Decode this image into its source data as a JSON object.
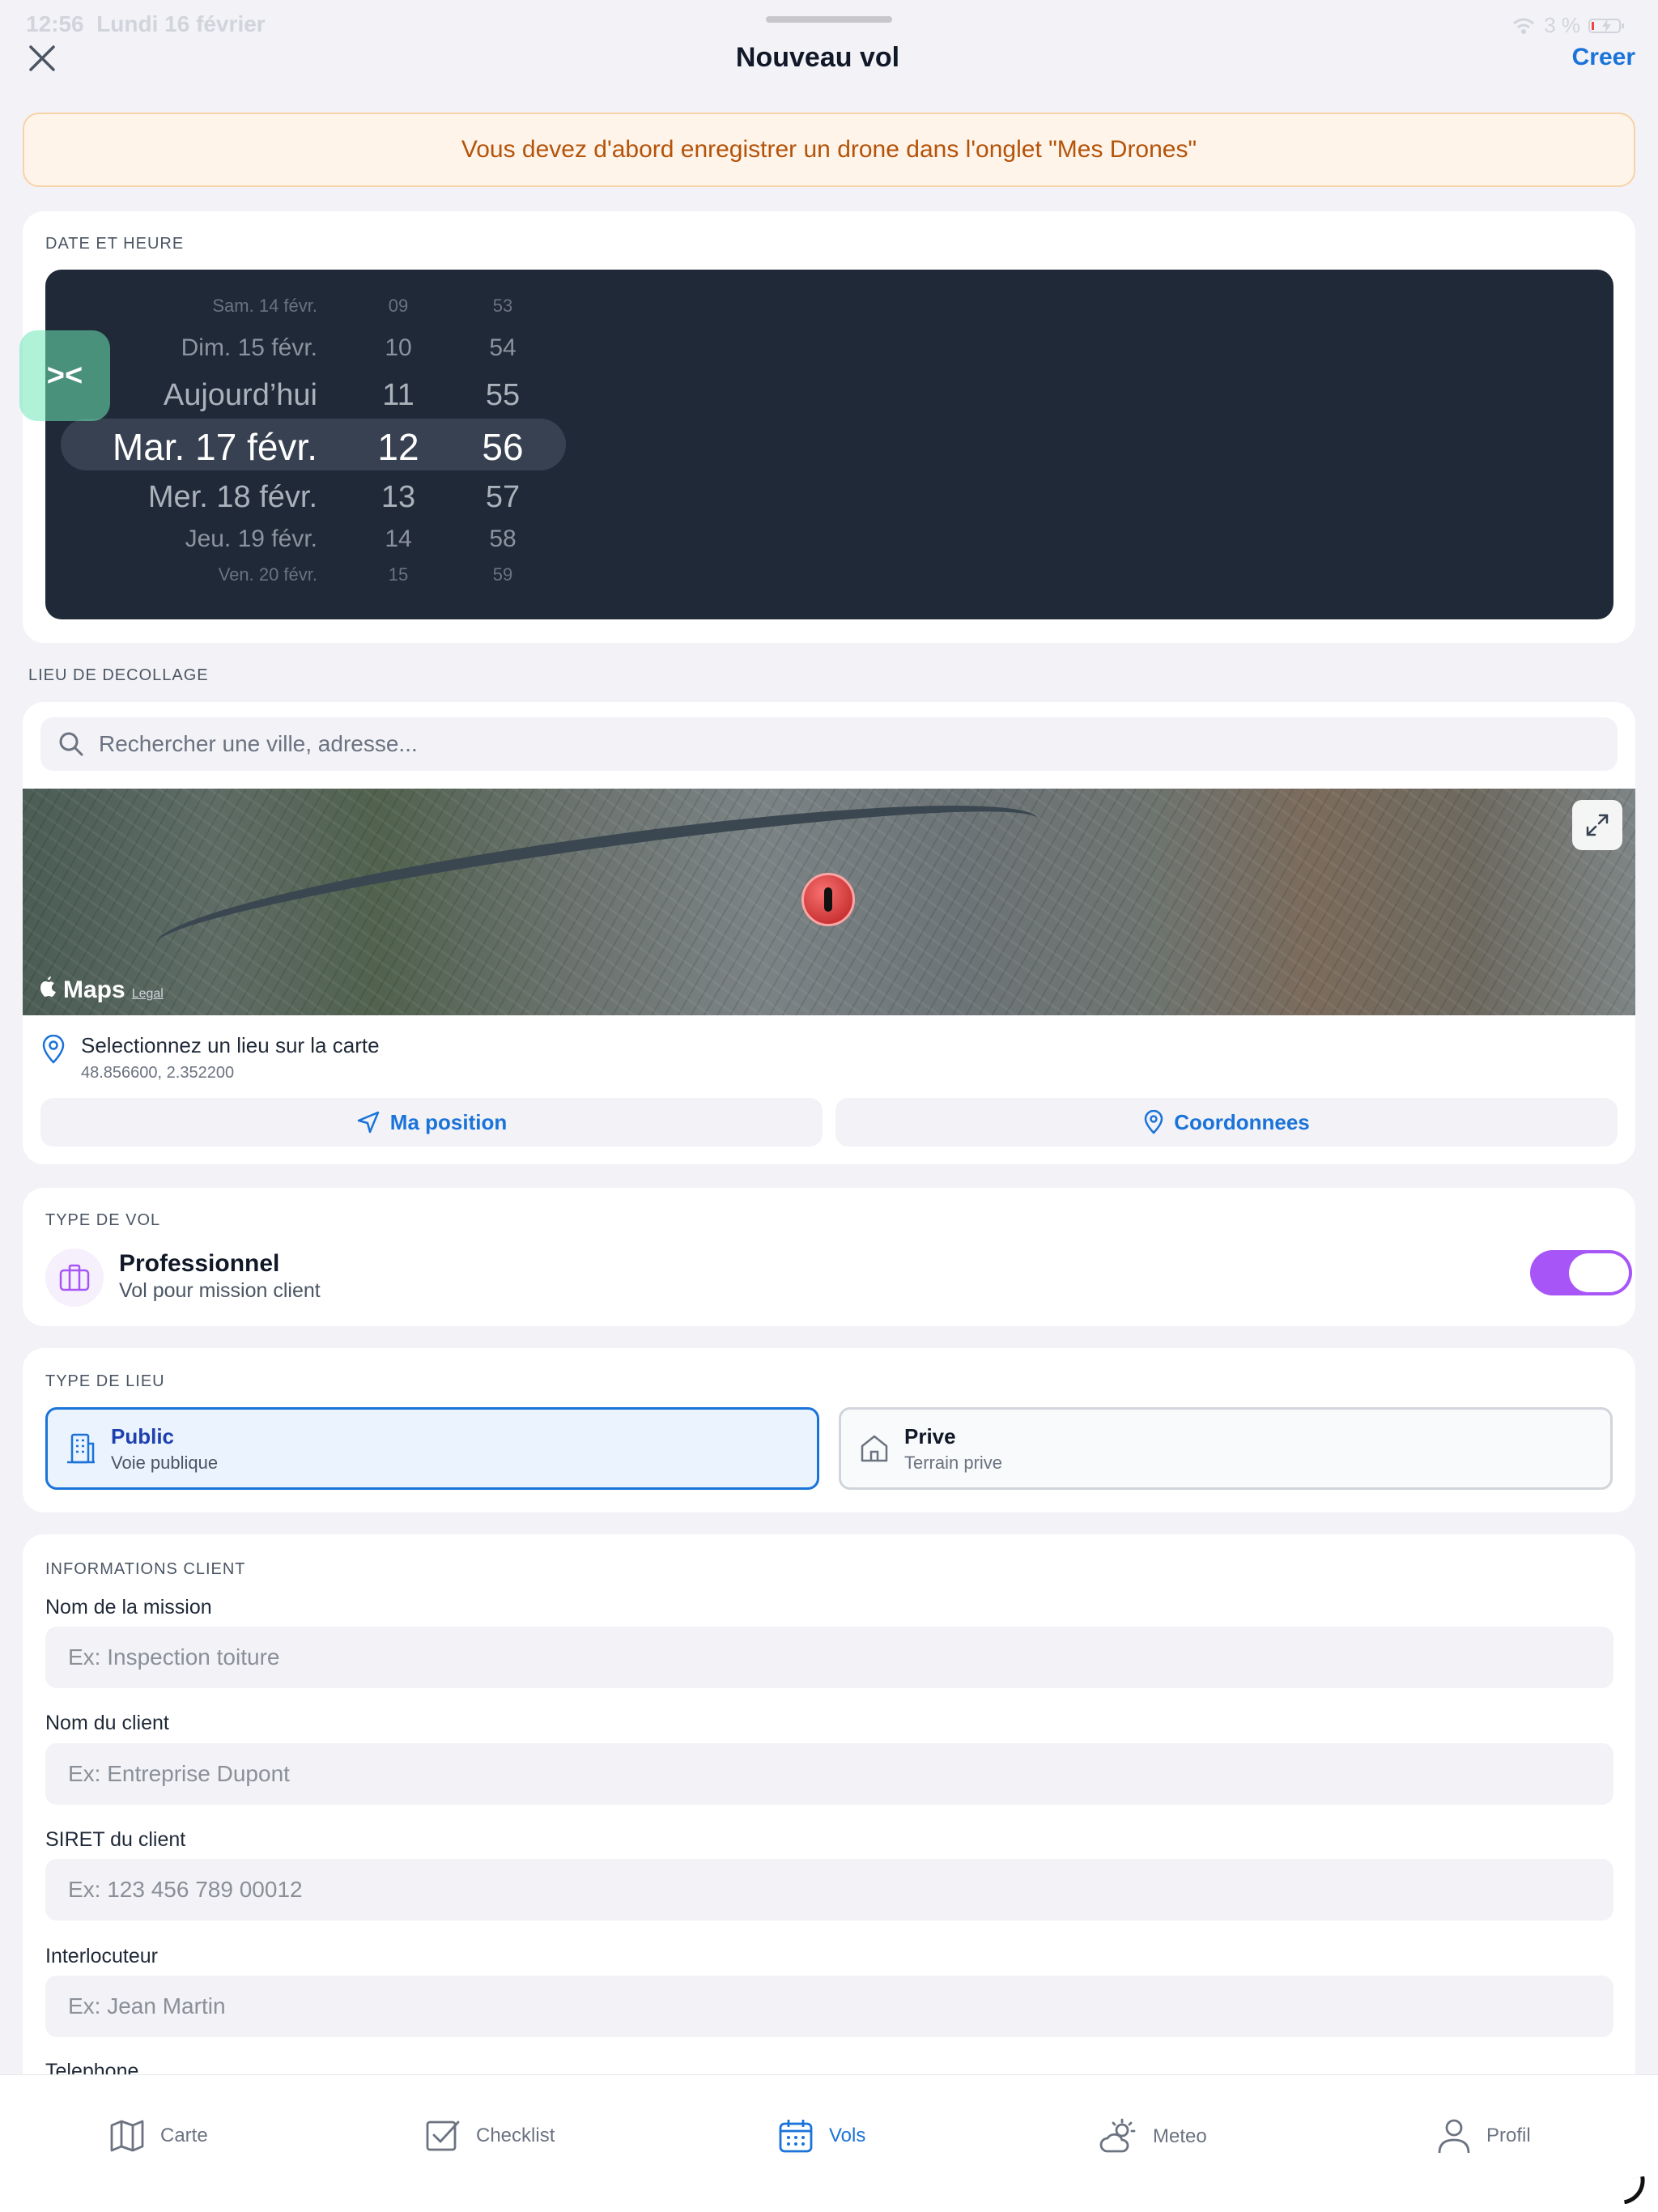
{
  "status_bar": {
    "time": "12:56",
    "date": "Lundi 16 février",
    "battery": "3 %"
  },
  "nav": {
    "title": "Nouveau vol",
    "create_label": "Creer"
  },
  "warning": "Vous devez d'abord enregistrer un drone dans l'onglet \"Mes Drones\"",
  "date_section": {
    "label": "DATE ET HEURE",
    "rows": [
      {
        "day": "Sam. 14 févr.",
        "hour": "09",
        "minute": "53"
      },
      {
        "day": "Dim. 15 févr.",
        "hour": "10",
        "minute": "54"
      },
      {
        "day": "Aujourd’hui",
        "hour": "11",
        "minute": "55"
      },
      {
        "day": "Mar. 17 févr.",
        "hour": "12",
        "minute": "56"
      },
      {
        "day": "Mer. 18 févr.",
        "hour": "13",
        "minute": "57"
      },
      {
        "day": "Jeu. 19 févr.",
        "hour": "14",
        "minute": "58"
      },
      {
        "day": "Ven. 20 févr.",
        "hour": "15",
        "minute": "59"
      }
    ],
    "handle_glyph": "><"
  },
  "takeoff": {
    "label": "LIEU DE DECOLLAGE",
    "search_placeholder": "Rechercher une ville, adresse...",
    "maps_brand": "Maps",
    "maps_legal": "Legal",
    "location_text": "Selectionnez un lieu sur la carte",
    "coordinates": "48.856600, 2.352200",
    "my_position_label": "Ma position",
    "coordinates_label": "Coordonnees"
  },
  "flight_type": {
    "label": "TYPE DE VOL",
    "title": "Professionnel",
    "subtitle": "Vol pour mission client",
    "toggle_on": true
  },
  "place_type": {
    "label": "TYPE DE LIEU",
    "options": [
      {
        "title": "Public",
        "subtitle": "Voie publique",
        "selected": true
      },
      {
        "title": "Prive",
        "subtitle": "Terrain prive",
        "selected": false
      }
    ]
  },
  "client_info": {
    "label": "INFORMATIONS CLIENT",
    "fields": [
      {
        "label": "Nom de la mission",
        "placeholder": "Ex: Inspection toiture"
      },
      {
        "label": "Nom du client",
        "placeholder": "Ex: Entreprise Dupont"
      },
      {
        "label": "SIRET du client",
        "placeholder": "Ex: 123 456 789 00012"
      },
      {
        "label": "Interlocuteur",
        "placeholder": "Ex: Jean Martin"
      },
      {
        "label": "Telephone",
        "placeholder": ""
      }
    ]
  },
  "tabs": [
    {
      "label": "Carte",
      "icon": "map-icon",
      "active": false
    },
    {
      "label": "Checklist",
      "icon": "checklist-icon",
      "active": false
    },
    {
      "label": "Vols",
      "icon": "calendar-icon",
      "active": true
    },
    {
      "label": "Meteo",
      "icon": "weather-icon",
      "active": false
    },
    {
      "label": "Profil",
      "icon": "user-icon",
      "active": false
    }
  ],
  "colors": {
    "accent": "#1a73d9",
    "toggle": "#a855f7",
    "warning_text": "#b45309",
    "picker_bg": "#1f2937"
  }
}
